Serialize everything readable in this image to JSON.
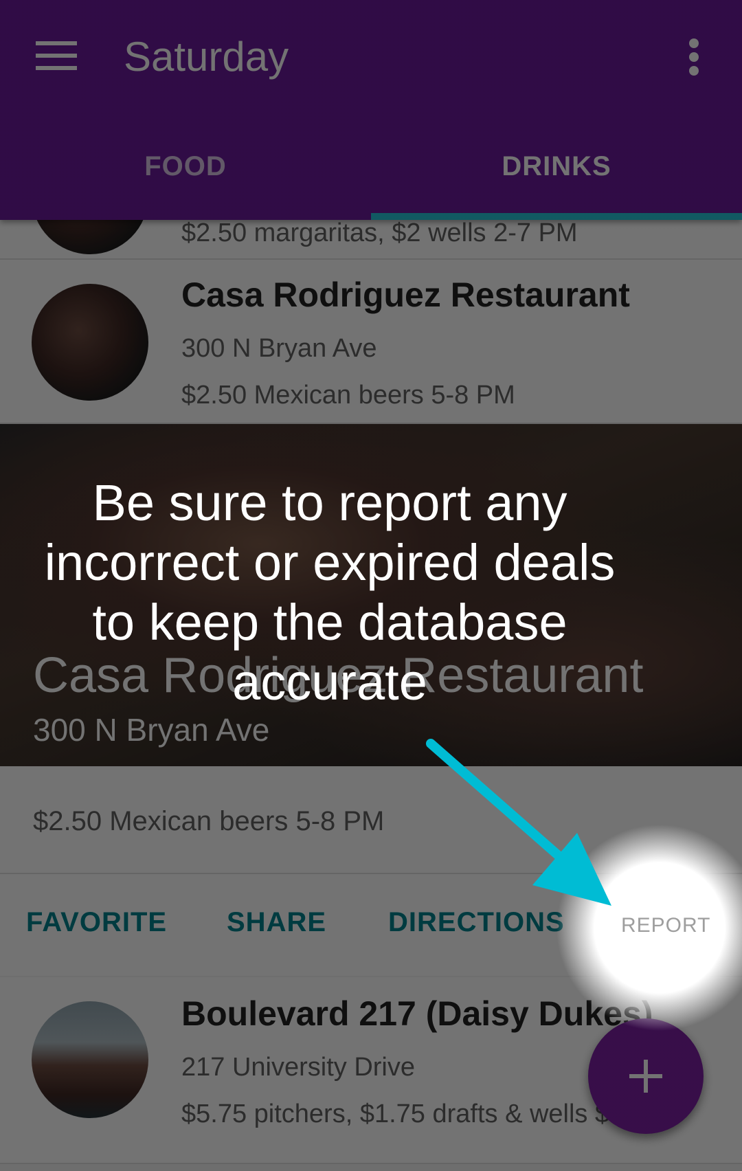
{
  "appbar": {
    "title": "Saturday",
    "background_color": "#6a1b9a",
    "menu_icon": "hamburger-menu-icon",
    "overflow_icon": "more-vertical-icon"
  },
  "tabs": [
    {
      "label": "FOOD",
      "active": false
    },
    {
      "label": "DRINKS",
      "active": true
    }
  ],
  "tab_indicator_color": "#26c6da",
  "list_top_partial": {
    "deal": "$2.50 margaritas, $2 wells 2-7 PM"
  },
  "list_item_1": {
    "name": "Casa Rodriguez Restaurant",
    "address": "300 N Bryan Ave",
    "deal": "$2.50 Mexican beers 5-8 PM"
  },
  "expanded_card": {
    "title": "Casa Rodriguez Restaurant",
    "address": "300 N Bryan Ave",
    "deal": "$2.50 Mexican beers 5-8 PM",
    "actions": {
      "favorite": "FAVORITE",
      "share": "SHARE",
      "directions": "DIRECTIONS",
      "report": "REPORT"
    },
    "action_color": "#00838f"
  },
  "list_item_2": {
    "name": "Boulevard 217 (Daisy Dukes)",
    "address": "217 University Drive",
    "deal": "$5.75 pitchers, $1.75 drafts & wells $2.50..."
  },
  "fab": {
    "icon": "plus-icon",
    "color": "#7b1fa2"
  },
  "coach_mark": {
    "text": "Be sure to report any incorrect or expired deals to keep the database accurate",
    "arrow_color": "#00bcd4"
  }
}
